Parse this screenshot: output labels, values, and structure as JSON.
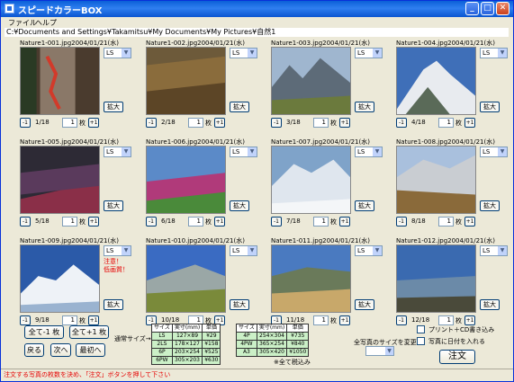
{
  "window": {
    "title": "スピードカラーBOX",
    "menu": [
      "ファイル",
      "ヘルプ"
    ]
  },
  "path": "C:¥Documents and Settings¥Takamitsu¥My Documents¥My Pictures¥自然1",
  "tiles": [
    {
      "caption": "Nature1-001.jpg2004/01/21(水)",
      "size": "LS",
      "position": "1/18",
      "qty": "1",
      "warning": ""
    },
    {
      "caption": "Nature1-002.jpg2004/01/21(水)",
      "size": "LS",
      "position": "2/18",
      "qty": "1",
      "warning": ""
    },
    {
      "caption": "Nature1-003.jpg2004/01/21(水)",
      "size": "LS",
      "position": "3/18",
      "qty": "1",
      "warning": ""
    },
    {
      "caption": "Nature1-004.jpg2004/01/21(水)",
      "size": "LS",
      "position": "4/18",
      "qty": "1",
      "warning": ""
    },
    {
      "caption": "Nature1-005.jpg2004/01/21(水)",
      "size": "LS",
      "position": "5/18",
      "qty": "1",
      "warning": ""
    },
    {
      "caption": "Nature1-006.jpg2004/01/21(水)",
      "size": "LS",
      "position": "6/18",
      "qty": "1",
      "warning": ""
    },
    {
      "caption": "Nature1-007.jpg2004/01/21(水)",
      "size": "LS",
      "position": "7/18",
      "qty": "1",
      "warning": ""
    },
    {
      "caption": "Nature1-008.jpg2004/01/21(水)",
      "size": "LS",
      "position": "8/18",
      "qty": "1",
      "warning": ""
    },
    {
      "caption": "Nature1-009.jpg2004/01/21(水)",
      "size": "LS",
      "position": "9/18",
      "qty": "1",
      "warning": "注意！\n低画質！"
    },
    {
      "caption": "Nature1-010.jpg2004/01/21(水)",
      "size": "LS",
      "position": "10/18",
      "qty": "1",
      "warning": ""
    },
    {
      "caption": "Nature1-011.jpg2004/01/21(水)",
      "size": "LS",
      "position": "11/18",
      "qty": "1",
      "warning": ""
    },
    {
      "caption": "Nature1-012.jpg2004/01/21(水)",
      "size": "LS",
      "position": "12/18",
      "qty": "1",
      "warning": ""
    }
  ],
  "labels": {
    "zoom": "拡大",
    "minus": "-1",
    "plus": "+1",
    "unit": "枚"
  },
  "nav": {
    "all_minus": "全て-1 枚",
    "all_plus": "全て+1 枚",
    "back": "戻る",
    "next": "次へ",
    "first": "最初へ"
  },
  "normal_size_label": "通常サイズ→",
  "price_table_1": {
    "headers": [
      "サイズ",
      "実寸(mm)",
      "単価"
    ],
    "rows": [
      [
        "LS",
        "127×89",
        "¥29"
      ],
      [
        "2LS",
        "178×127",
        "¥158"
      ],
      [
        "6P",
        "203×254",
        "¥525"
      ],
      [
        "6PW",
        "305×203",
        "¥630"
      ]
    ]
  },
  "price_table_2": {
    "headers": [
      "サイズ",
      "実寸(mm)",
      "単価"
    ],
    "rows": [
      [
        "4P",
        "254×304",
        "¥735"
      ],
      [
        "4PW",
        "365×254",
        "¥840"
      ],
      [
        "A3",
        "305×420",
        "¥1050"
      ]
    ]
  },
  "tax_note": "※全て税込み",
  "all_size_label": "全写真のサイズを変更",
  "options": {
    "print_cd": "プリント＋CD書き込み",
    "date_on_photo": "写真に日付を入れる"
  },
  "order_button": "注文",
  "status": "注文する写真の枚数を決め、「注文」ボタンを押して下さい"
}
